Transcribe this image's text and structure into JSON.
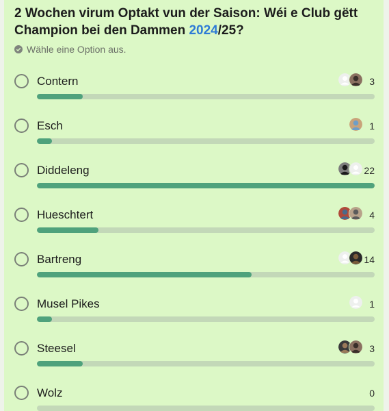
{
  "poll": {
    "title_part1": "2 Wochen virum Optakt vun der Saison: Wéi e Club gëtt Champion bei den Dammen ",
    "title_highlight": "2024",
    "title_part2": "/25?",
    "hint": "Wähle eine Option aus.",
    "icons": {
      "hint": "check-circle-icon",
      "radio": "radio-circle-icon",
      "avatar": "user-avatar"
    },
    "colors": {
      "background": "#dcf8c6",
      "bar_fill": "#4fa27c",
      "bar_track": "#c3d8b8",
      "highlight": "#2e7bd6"
    },
    "max_votes": 22,
    "options": [
      {
        "label": "Contern",
        "votes": "3",
        "avatars": [
          "placeholder",
          "photo"
        ]
      },
      {
        "label": "Esch",
        "votes": "1",
        "avatars": [
          "photo"
        ]
      },
      {
        "label": "Diddeleng",
        "votes": "22",
        "avatars": [
          "photo",
          "placeholder"
        ]
      },
      {
        "label": "Hueschtert",
        "votes": "4",
        "avatars": [
          "photo",
          "photo"
        ]
      },
      {
        "label": "Bartreng",
        "votes": "14",
        "avatars": [
          "placeholder",
          "photo"
        ]
      },
      {
        "label": "Musel Pikes",
        "votes": "1",
        "avatars": [
          "placeholder"
        ]
      },
      {
        "label": "Steesel",
        "votes": "3",
        "avatars": [
          "photo",
          "photo"
        ]
      },
      {
        "label": "Wolz",
        "votes": "0",
        "avatars": []
      }
    ]
  }
}
